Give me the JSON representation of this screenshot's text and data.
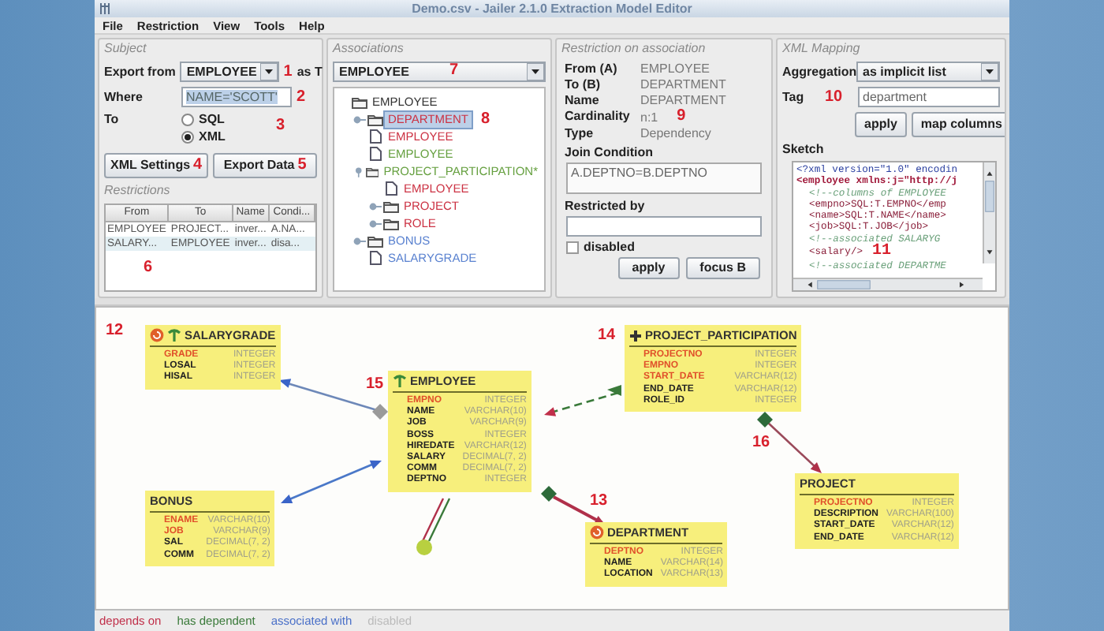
{
  "window": {
    "title": "Demo.csv - Jailer 2.1.0 Extraction Model Editor"
  },
  "menu": [
    "File",
    "Restriction",
    "View",
    "Tools",
    "Help"
  ],
  "subject": {
    "title": "Subject",
    "export_from_label": "Export from",
    "export_from": "EMPLOYEE",
    "export_from_callout": "1",
    "as_label": "as T",
    "where_label": "Where",
    "where": "NAME='SCOTT'",
    "where_callout": "2",
    "to_label": "To",
    "formats": [
      {
        "label": "SQL",
        "selected": false
      },
      {
        "label": "XML",
        "selected": true
      }
    ],
    "formats_callout": "3",
    "buttons": [
      {
        "label": "XML Settings",
        "callout": "4"
      },
      {
        "label": "Export Data",
        "callout": "5"
      }
    ],
    "restrictions_title": "Restrictions",
    "restrictions": {
      "columns": [
        "From",
        "To",
        "Name",
        "Condi..."
      ],
      "rows": [
        [
          "EMPLOYEE",
          "PROJECT...",
          "inver...",
          "A.NA..."
        ],
        [
          "SALARY...",
          "EMPLOYEE",
          "inver...",
          "disa..."
        ]
      ]
    },
    "restrictions_callout": "6"
  },
  "associations": {
    "title": "Associations",
    "table": "EMPLOYEE",
    "table_callout": "7",
    "tree": {
      "label": "EMPLOYEE",
      "kind": "folder",
      "selected": false,
      "children": [
        {
          "label": "DEPARTMENT",
          "kind": "folder",
          "color": "#cc3344",
          "selected": true,
          "expanded": false,
          "callout": "8"
        },
        {
          "label": "EMPLOYEE",
          "kind": "leaf",
          "color": "#cc3344",
          "selected": false
        },
        {
          "label": "EMPLOYEE",
          "kind": "leaf",
          "color": "#66a040",
          "selected": false
        },
        {
          "label": "PROJECT_PARTICIPATION*",
          "kind": "folder",
          "color": "#66a040",
          "selected": false,
          "expanded": true,
          "children": [
            {
              "label": "EMPLOYEE",
              "kind": "leaf",
              "color": "#cc3344",
              "selected": false
            },
            {
              "label": "PROJECT",
              "kind": "folder",
              "color": "#cc3344",
              "selected": false,
              "expanded": false
            },
            {
              "label": "ROLE",
              "kind": "folder",
              "color": "#cc3344",
              "selected": false,
              "expanded": false
            }
          ]
        },
        {
          "label": "BONUS",
          "kind": "folder",
          "color": "#5a82d0",
          "selected": false,
          "expanded": false
        },
        {
          "label": "SALARYGRADE",
          "kind": "leaf",
          "color": "#5a82d0",
          "selected": false
        }
      ]
    }
  },
  "restriction": {
    "title": "Restriction on association",
    "fields": [
      {
        "label": "From (A)",
        "value": "EMPLOYEE"
      },
      {
        "label": "To (B)",
        "value": "DEPARTMENT"
      },
      {
        "label": "Name",
        "value": "DEPARTMENT"
      },
      {
        "label": "Cardinality",
        "value": "n:1",
        "callout": "9"
      },
      {
        "label": "Type",
        "value": "Dependency"
      }
    ],
    "join_label": "Join Condition",
    "join": "A.DEPTNO=B.DEPTNO",
    "restricted_by_label": "Restricted by",
    "disabled": {
      "label": "disabled",
      "checked": false
    },
    "buttons": [
      "apply",
      "focus B"
    ]
  },
  "xml_mapping": {
    "title": "XML Mapping",
    "aggregation_label": "Aggregation",
    "aggregation": "as implicit list",
    "tag_label": "Tag",
    "tag": "department",
    "tag_callout": "10",
    "buttons": [
      "apply",
      "map columns"
    ],
    "sketch_label": "Sketch",
    "sketch": [
      {
        "kind": "declaration",
        "text": "<?xml version=\"1.0\" encodin"
      },
      {
        "kind": "root",
        "text": "<employee xmlns:j=\"http://j"
      },
      {
        "kind": "comment",
        "text": "<!--columns of EMPLOYEE"
      },
      {
        "kind": "element",
        "text": "<empno>SQL:T.EMPNO</emp"
      },
      {
        "kind": "element",
        "text": "<name>SQL:T.NAME</name>"
      },
      {
        "kind": "element",
        "text": "<job>SQL:T.JOB</job>"
      },
      {
        "kind": "comment",
        "text": "<!--associated SALARYG"
      },
      {
        "kind": "element",
        "text": "<salary/>",
        "callout": "11"
      },
      {
        "kind": "comment",
        "text": "<!--associated DEPARTME"
      }
    ]
  },
  "diagram": {
    "tables": [
      {
        "name": "SALARYGRADE",
        "callout": "12",
        "markers": [
          {
            "kind": "dependency"
          },
          {
            "kind": "root"
          }
        ],
        "columns": [
          {
            "name": "GRADE",
            "type": "INTEGER",
            "key": true
          },
          {
            "name": "LOSAL",
            "type": "INTEGER",
            "key": false
          },
          {
            "name": "HISAL",
            "type": "INTEGER",
            "key": false
          }
        ]
      },
      {
        "name": "EMPLOYEE",
        "callout": "15",
        "markers": [
          {
            "kind": "root"
          }
        ],
        "columns": [
          {
            "name": "EMPNO",
            "type": "INTEGER",
            "key": true
          },
          {
            "name": "NAME",
            "type": "VARCHAR(10)",
            "key": false
          },
          {
            "name": "JOB",
            "type": "VARCHAR(9)",
            "key": false
          },
          {
            "name": "BOSS",
            "type": "INTEGER",
            "key": false
          },
          {
            "name": "HIREDATE",
            "type": "VARCHAR(12)",
            "key": false
          },
          {
            "name": "SALARY",
            "type": "DECIMAL(7, 2)",
            "key": false
          },
          {
            "name": "COMM",
            "type": "DECIMAL(7, 2)",
            "key": false
          },
          {
            "name": "DEPTNO",
            "type": "INTEGER",
            "key": false
          }
        ]
      },
      {
        "name": "BONUS",
        "columns": [
          {
            "name": "ENAME",
            "type": "VARCHAR(10)",
            "key": true
          },
          {
            "name": "JOB",
            "type": "VARCHAR(9)",
            "key": true
          },
          {
            "name": "SAL",
            "type": "DECIMAL(7, 2)",
            "key": false
          },
          {
            "name": "COMM",
            "type": "DECIMAL(7, 2)",
            "key": false
          }
        ]
      },
      {
        "name": "PROJECT_PARTICIPATION",
        "callout": "14",
        "markers": [
          {
            "kind": "plus"
          }
        ],
        "columns": [
          {
            "name": "PROJECTNO",
            "type": "INTEGER",
            "key": true
          },
          {
            "name": "EMPNO",
            "type": "INTEGER",
            "key": true
          },
          {
            "name": "START_DATE",
            "type": "VARCHAR(12)",
            "key": true
          },
          {
            "name": "END_DATE",
            "type": "VARCHAR(12)",
            "key": false
          },
          {
            "name": "ROLE_ID",
            "type": "INTEGER",
            "key": false
          }
        ]
      },
      {
        "name": "DEPARTMENT",
        "callout": "13",
        "markers": [
          {
            "kind": "dependency"
          }
        ],
        "columns": [
          {
            "name": "DEPTNO",
            "type": "INTEGER",
            "key": true
          },
          {
            "name": "NAME",
            "type": "VARCHAR(14)",
            "key": false
          },
          {
            "name": "LOCATION",
            "type": "VARCHAR(13)",
            "key": false
          }
        ]
      },
      {
        "name": "PROJECT",
        "callout": "16",
        "columns": [
          {
            "name": "PROJECTNO",
            "type": "INTEGER",
            "key": true
          },
          {
            "name": "DESCRIPTION",
            "type": "VARCHAR(100)",
            "key": false
          },
          {
            "name": "START_DATE",
            "type": "VARCHAR(12)",
            "key": false
          },
          {
            "name": "END_DATE",
            "type": "VARCHAR(12)",
            "key": false
          }
        ]
      }
    ]
  },
  "legend": [
    {
      "label": "depends on",
      "color": "#c0304a"
    },
    {
      "label": "has dependent",
      "color": "#3a7a3a"
    },
    {
      "label": "associated with",
      "color": "#4a70c8"
    },
    {
      "label": "disabled",
      "color": "#bbbbbb"
    }
  ]
}
